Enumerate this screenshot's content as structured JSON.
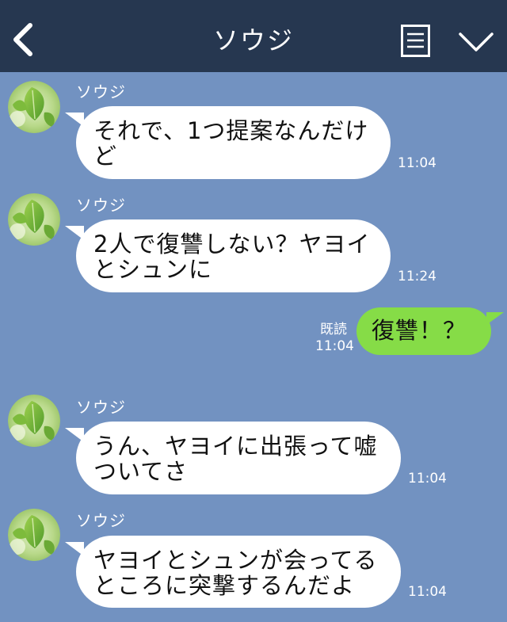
{
  "header": {
    "title": "ソウジ",
    "back_icon": "chevron-left-icon",
    "menu_icon": "notes-icon",
    "collapse_icon": "chevron-down-icon",
    "background": "#263750"
  },
  "colors": {
    "chat_background": "#7292c1",
    "incoming_bubble": "#ffffff",
    "outgoing_bubble": "#86dc47"
  },
  "messages": [
    {
      "direction": "incoming",
      "sender": "ソウジ",
      "lines": [
        "それで、1つ提案なんだけ",
        "ど"
      ],
      "time": "11:04"
    },
    {
      "direction": "incoming",
      "sender": "ソウジ",
      "lines": [
        "2人で復讐しない？ヤヨイ",
        "とシュンに"
      ],
      "time": "11:24"
    },
    {
      "direction": "outgoing",
      "lines": [
        "復讐！？"
      ],
      "read": "既読",
      "time": "11:04"
    },
    {
      "direction": "incoming",
      "sender": "ソウジ",
      "lines": [
        "うん、ヤヨイに出張って嘘",
        "ついてさ"
      ],
      "time": "11:04"
    },
    {
      "direction": "incoming",
      "sender": "ソウジ",
      "lines": [
        "ヤヨイとシュンが会ってる",
        "ところに突撃するんだよ"
      ],
      "time": "11:04"
    }
  ]
}
